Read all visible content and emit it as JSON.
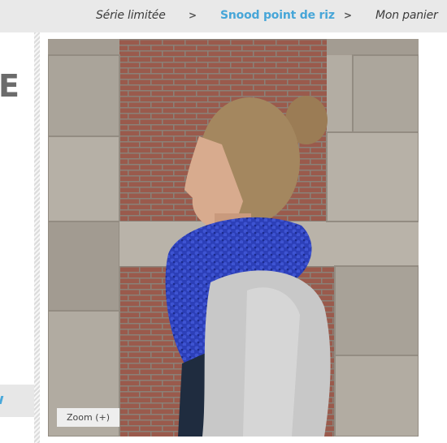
{
  "breadcrumb": {
    "items": [
      "Série limitée",
      "Snood point de riz",
      "Mon panier"
    ],
    "separator": ">"
  },
  "sidebar": {
    "title_fragment": "E"
  },
  "photo": {
    "zoom_label": "Zoom (+)"
  },
  "colors": {
    "accent": "#47a6d8",
    "scarf": "#2a3fb5"
  }
}
